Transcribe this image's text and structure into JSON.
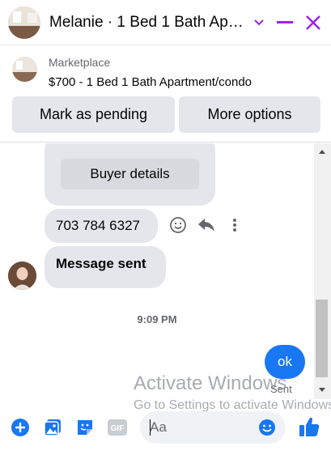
{
  "header": {
    "title": "Melanie · 1 Bed 1 Bath Apa…",
    "icons": [
      "avatar",
      "chevron-down-icon",
      "minimize-icon",
      "close-icon"
    ]
  },
  "marketplace": {
    "label": "Marketplace",
    "listing": "$700 - 1 Bed 1 Bath Apartment/condo",
    "buttons": {
      "mark_pending": "Mark as pending",
      "more_options": "More options"
    }
  },
  "chat": {
    "buyer_details_label": "Buyer details",
    "messages": [
      {
        "from": "them",
        "text": "703 784 6327"
      },
      {
        "from": "them",
        "text": "Message sent"
      },
      {
        "from": "me",
        "text": "ok"
      }
    ],
    "time": "9:09 PM",
    "status": "Sent"
  },
  "watermark": {
    "title": "Activate Windows",
    "subtitle": "Go to Settings to activate Windows."
  },
  "composer": {
    "placeholder": "Aa",
    "gif_label": "GIF"
  },
  "colors": {
    "accent": "#1877f2",
    "header_icons": "#a020f0",
    "bubble_gray": "#e4e6eb"
  }
}
